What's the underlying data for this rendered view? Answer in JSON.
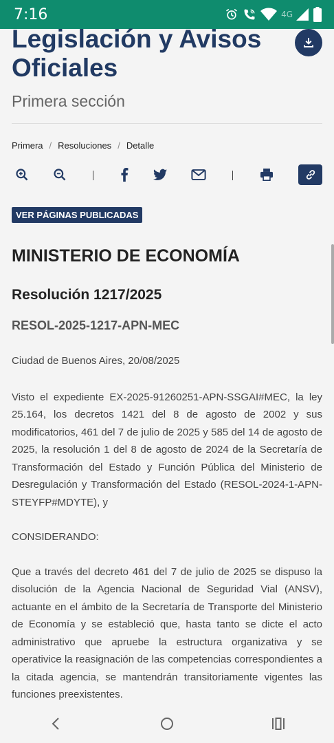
{
  "status_bar": {
    "time": "7:16",
    "network": "4G"
  },
  "page": {
    "title": "Legislación y Avisos Oficiales",
    "subtitle": "Primera sección",
    "breadcrumb": [
      "Primera",
      "Resoluciones",
      "Detalle"
    ],
    "ver_paginas": "VER PÁGINAS PUBLICADAS"
  },
  "document": {
    "ministerio": "MINISTERIO DE ECONOMÍA",
    "resolucion": "Resolución 1217/2025",
    "codigo": "RESOL-2025-1217-APN-MEC",
    "fecha": "Ciudad de Buenos Aires, 20/08/2025",
    "visto": "Visto el expediente EX-2025-91260251-APN-SSGAI#MEC, la ley 25.164, los decretos 1421 del 8 de agosto de 2002 y sus modificatorios, 461 del 7 de julio de 2025 y 585 del 14 de agosto de 2025, la resolución 1 del 8 de agosto de 2024 de la Secretaría de Transformación del Estado y Función Pública del Ministerio de Desregulación y Transformación del Estado (RESOL-2024-1-APN-STEYFP#MDYTE), y",
    "considerando": "CONSIDERANDO:",
    "parrafo1": "Que a través del decreto 461 del 7 de julio de 2025 se dispuso la disolución de la Agencia Nacional de Seguridad Vial (ANSV), actuante en el ámbito de la Secretaría de Transporte del Ministerio de Economía y se estableció que, hasta tanto se dicte el acto administrativo que apruebe la estructura organizativa y se operativice la reasignación de las competencias correspondientes a la citada agencia, se mantendrán transitoriamente vigentes las funciones preexistentes."
  },
  "colors": {
    "status_bar": "#0f8c6e",
    "brand_navy": "#223a64"
  }
}
